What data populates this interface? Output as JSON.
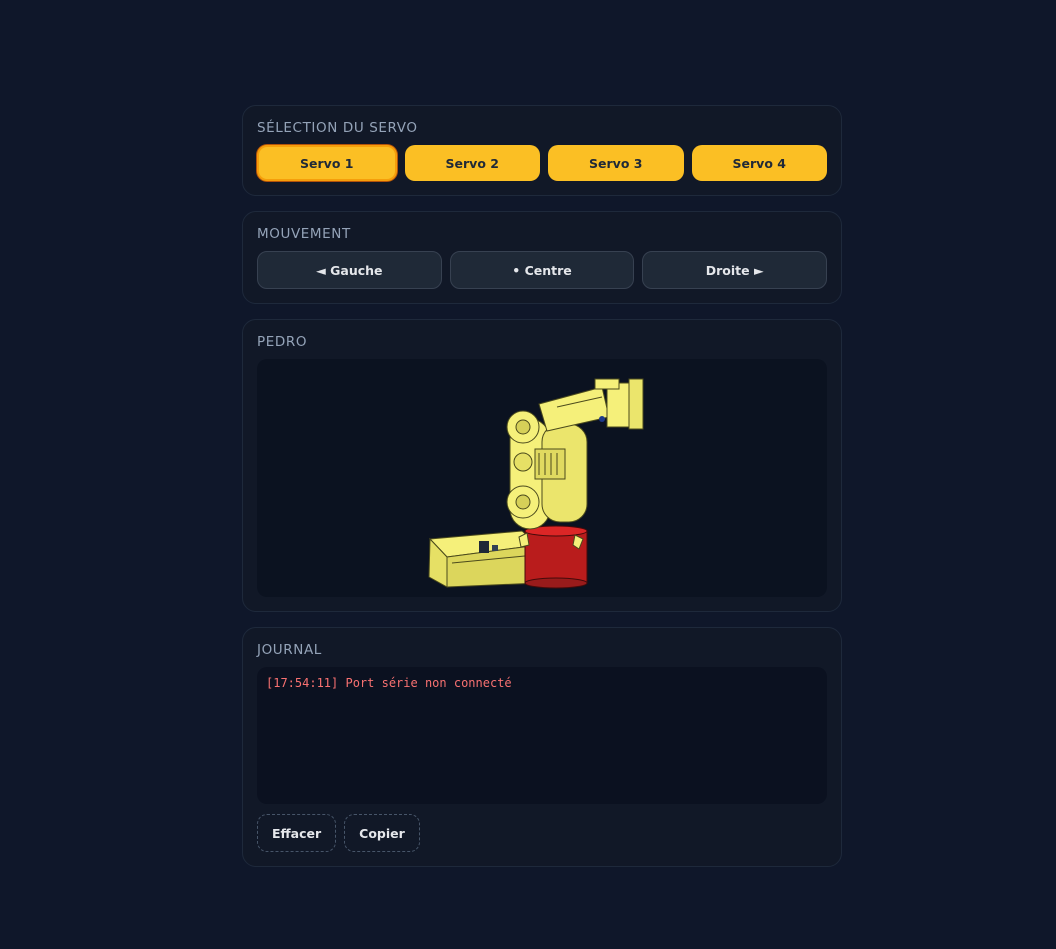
{
  "servo_section": {
    "title": "SÉLECTION DU SERVO",
    "buttons": [
      "Servo 1",
      "Servo 2",
      "Servo 3",
      "Servo 4"
    ],
    "active": "Servo 1"
  },
  "movement_section": {
    "title": "MOUVEMENT",
    "left_label": "◄ Gauche",
    "center_label": "• Centre",
    "right_label": "Droite ►"
  },
  "model_section": {
    "title": "PEDRO",
    "colors": {
      "arm": "#f5f07a",
      "base": "#b91c1c",
      "viewport_bg": "#0b1220"
    }
  },
  "log_section": {
    "title": "JOURNAL",
    "lines": [
      "[17:54:11] Port série non connecté"
    ],
    "clear_label": "Effacer",
    "copy_label": "Copier"
  },
  "theme": {
    "background": "#0f172a",
    "accent": "#fbbf24",
    "error": "#f87171"
  }
}
